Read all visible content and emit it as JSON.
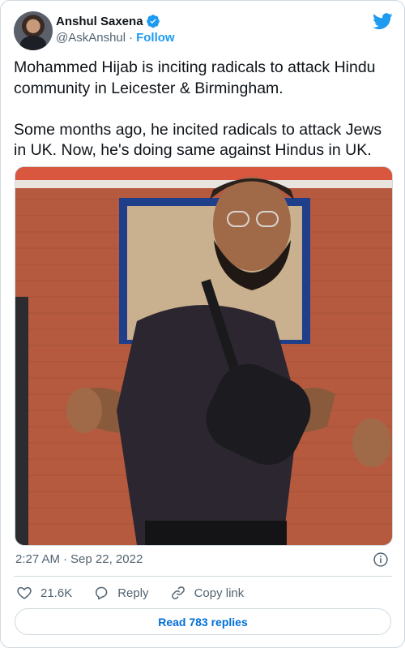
{
  "author": {
    "display_name": "Anshul Saxena",
    "handle": "@AskAnshul",
    "follow_label": "Follow",
    "separator": "·"
  },
  "tweet": {
    "text": "Mohammed Hijab is inciting radicals to attack Hindu community in Leicester & Birmingham.\n\nSome months ago, he incited radicals to attack Jews in UK. Now, he's doing same against Hindus in UK.",
    "time": "2:27 AM",
    "date_separator": "·",
    "date": "Sep 22, 2022"
  },
  "actions": {
    "like_count": "21.6K",
    "reply_label": "Reply",
    "copy_link_label": "Copy link"
  },
  "footer": {
    "read_replies_label": "Read 783 replies"
  },
  "colors": {
    "accent": "#1d9bf0",
    "link": "#006fd6",
    "secondary_text": "#536471",
    "border": "#cfd9de"
  },
  "icons": [
    "verified-badge-icon",
    "twitter-bird-icon",
    "info-icon",
    "heart-icon",
    "reply-bubble-icon",
    "link-icon"
  ]
}
